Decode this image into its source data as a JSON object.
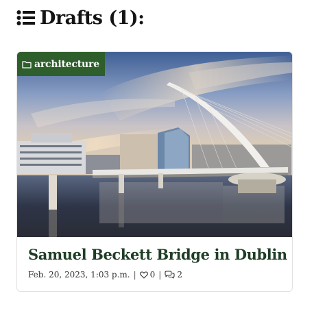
{
  "page": {
    "heading": "Drafts (1):",
    "heading_icon": "list-icon"
  },
  "draft": {
    "category": "architecture",
    "category_icon": "folder-icon",
    "title": "Samuel Beckett Bridge in Dublin",
    "date": "Feb. 20, 2023, 1:03 p.m.",
    "separator": "|",
    "likes": "0",
    "likes_icon": "heart-icon",
    "comments": "2",
    "comments_icon": "comments-icon",
    "image_subject": "bridge-photo"
  },
  "colors": {
    "badge_bg": "#2e5e2b",
    "title_green": "#1f3d25",
    "border": "#e1e1e1"
  }
}
